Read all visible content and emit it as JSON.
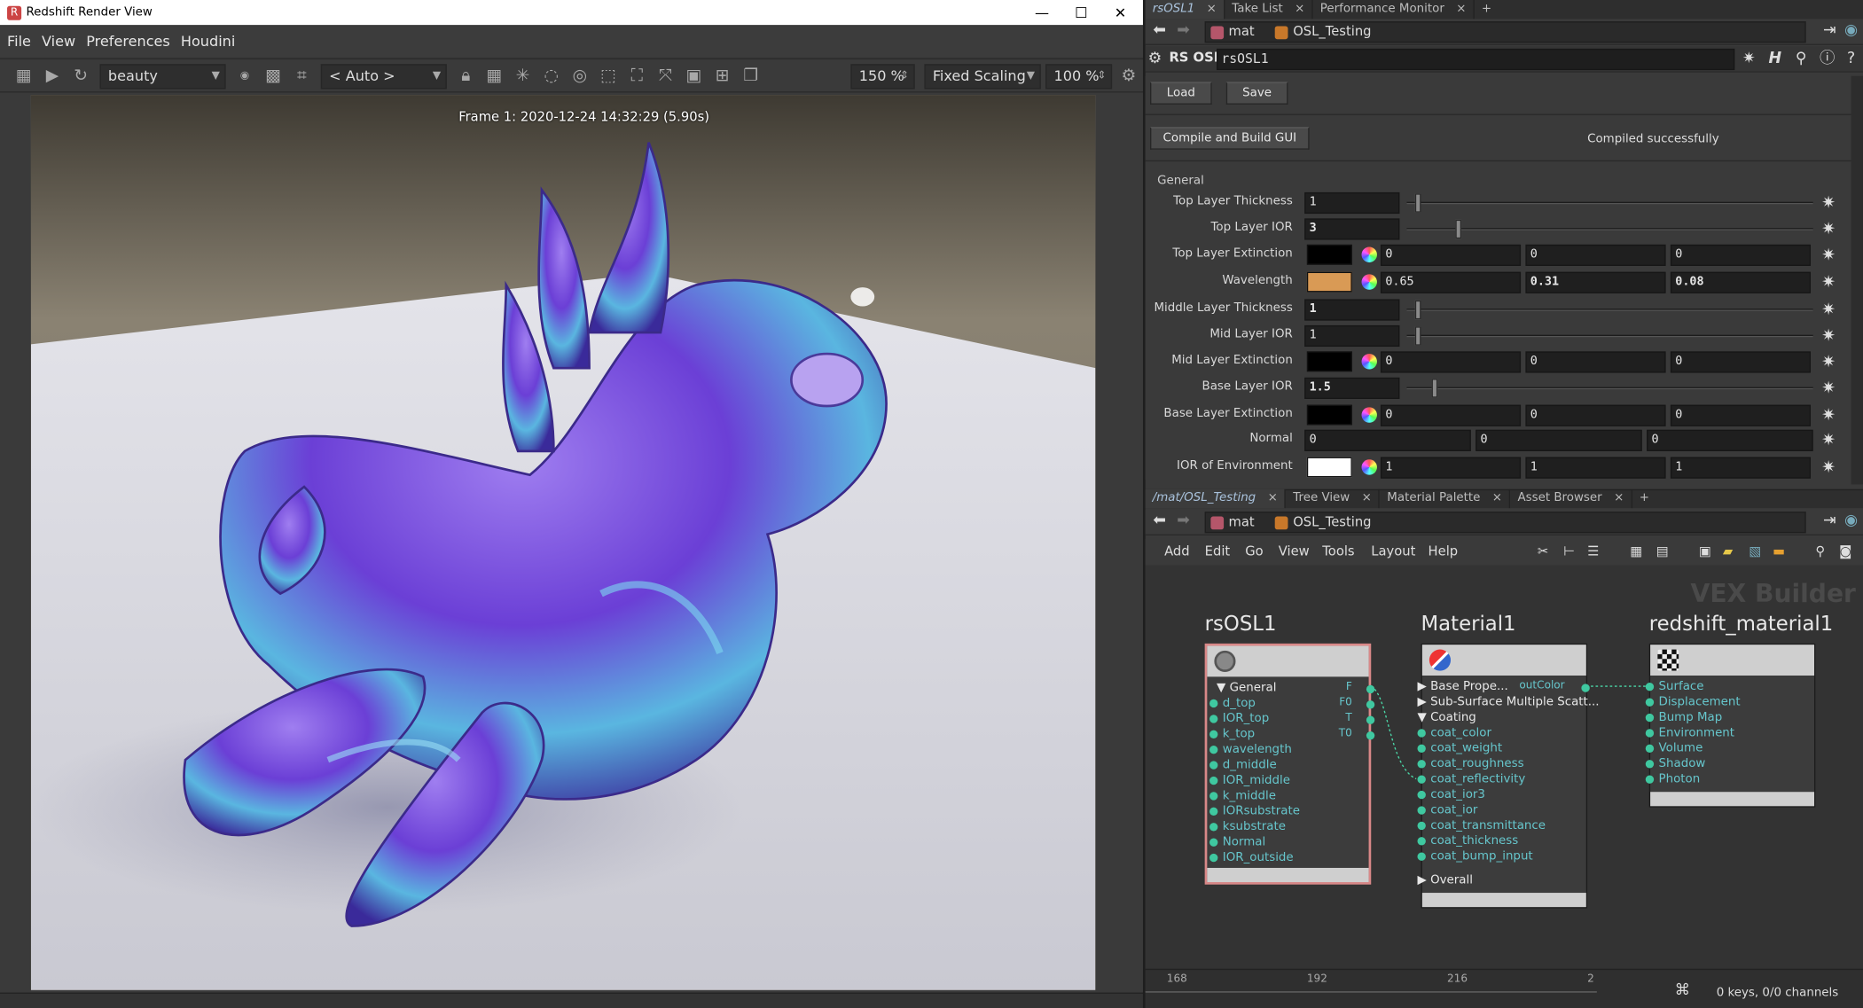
{
  "render_view": {
    "title": "Redshift Render View",
    "window_controls": {
      "minimize": "—",
      "maximize": "☐",
      "close": "✕"
    },
    "menu": [
      "File",
      "View",
      "Preferences",
      "Houdini"
    ],
    "toolbar": {
      "aov": "beauty",
      "camera": "< Auto >",
      "zoom": "150 %",
      "scaling": "Fixed Scaling",
      "exposure": "100 %"
    },
    "frame_info": "Frame 1: 2020-12-24 14:32:29 (5.90s)"
  },
  "top_tabs": [
    {
      "label": "rsOSL1",
      "active": true
    },
    {
      "label": "Take List",
      "active": false
    },
    {
      "label": "Performance Monitor",
      "active": false
    }
  ],
  "path": {
    "context": "mat",
    "node": "OSL_Testing"
  },
  "parm_header": {
    "type": "RS OSL",
    "name": "rsOSL1"
  },
  "buttons": {
    "load": "Load",
    "save": "Save",
    "compile": "Compile and Build GUI"
  },
  "compile_status": "Compiled successfully",
  "folder": "General",
  "parameters": [
    {
      "label": "Top Layer Thickness",
      "kind": "slider",
      "value": "1",
      "fraction": 0.02,
      "bold": false
    },
    {
      "label": "Top Layer IOR",
      "kind": "slider",
      "value": "3",
      "fraction": 0.12,
      "bold": true
    },
    {
      "label": "Top Layer Extinction",
      "kind": "color",
      "swatch": "#000000",
      "values": [
        "0",
        "0",
        "0"
      ],
      "bold": false
    },
    {
      "label": "Wavelength",
      "kind": "color",
      "swatch": "#d99a55",
      "values": [
        "0.65",
        "0.31",
        "0.08"
      ],
      "bold": true
    },
    {
      "label": "Middle Layer Thickness",
      "kind": "slider",
      "value": "1",
      "fraction": 0.02,
      "bold": true
    },
    {
      "label": "Mid Layer IOR",
      "kind": "slider",
      "value": "1",
      "fraction": 0.02,
      "bold": false
    },
    {
      "label": "Mid Layer Extinction",
      "kind": "color",
      "swatch": "#000000",
      "values": [
        "0",
        "0",
        "0"
      ],
      "bold": false
    },
    {
      "label": "Base Layer IOR",
      "kind": "slider",
      "value": "1.5",
      "fraction": 0.06,
      "bold": true
    },
    {
      "label": "Base Layer Extinction",
      "kind": "color",
      "swatch": "#000000",
      "values": [
        "0",
        "0",
        "0"
      ],
      "bold": false
    },
    {
      "label": "Normal",
      "kind": "vector",
      "values": [
        "0",
        "0",
        "0"
      ],
      "bold": false
    },
    {
      "label": "IOR of Environment",
      "kind": "color",
      "swatch": "#ffffff",
      "values": [
        "1",
        "1",
        "1"
      ],
      "bold": false
    }
  ],
  "network_tabs": [
    {
      "label": "/mat/OSL_Testing",
      "active": true
    },
    {
      "label": "Tree View",
      "active": false
    },
    {
      "label": "Material Palette",
      "active": false
    },
    {
      "label": "Asset Browser",
      "active": false
    }
  ],
  "network_menu": [
    "Add",
    "Edit",
    "Go",
    "View",
    "Tools",
    "Layout",
    "Help"
  ],
  "network_label": "VEX Builder",
  "nodes": {
    "osl": {
      "title": "rsOSL1",
      "folder": "General",
      "inputs": [
        "d_top",
        "IOR_top",
        "k_top",
        "wavelength",
        "d_middle",
        "IOR_middle",
        "k_middle",
        "IORsubstrate",
        "ksubstrate",
        "Normal",
        "IOR_outside"
      ],
      "outputs": [
        "F",
        "F0",
        "T",
        "T0"
      ]
    },
    "material": {
      "title": "Material1",
      "rows": [
        {
          "label": "Base Prope...",
          "type": "collapsed"
        },
        {
          "label": "Sub-Surface Multiple Scatt...",
          "type": "collapsed"
        },
        {
          "label": "Coating",
          "type": "expanded"
        },
        {
          "label": "coat_color",
          "type": "input"
        },
        {
          "label": "coat_weight",
          "type": "input"
        },
        {
          "label": "coat_roughness",
          "type": "input"
        },
        {
          "label": "coat_reflectivity",
          "type": "input"
        },
        {
          "label": "coat_ior3",
          "type": "input"
        },
        {
          "label": "coat_ior",
          "type": "input"
        },
        {
          "label": "coat_transmittance",
          "type": "input"
        },
        {
          "label": "coat_thickness",
          "type": "input"
        },
        {
          "label": "coat_bump_input",
          "type": "input"
        },
        {
          "label": "Overall",
          "type": "collapsed"
        }
      ],
      "output": "outColor"
    },
    "redshift": {
      "title": "redshift_material1",
      "inputs": [
        "Surface",
        "Displacement",
        "Bump Map",
        "Environment",
        "Volume",
        "Shadow",
        "Photon"
      ]
    }
  },
  "timeline": {
    "ticks": [
      "168",
      "192",
      "216",
      "2"
    ],
    "keys": "0 keys, 0/0 channels"
  },
  "colors": {
    "port": "#3fc8a0",
    "port_text": "#66c6cc",
    "selected_border": "#d98888"
  }
}
